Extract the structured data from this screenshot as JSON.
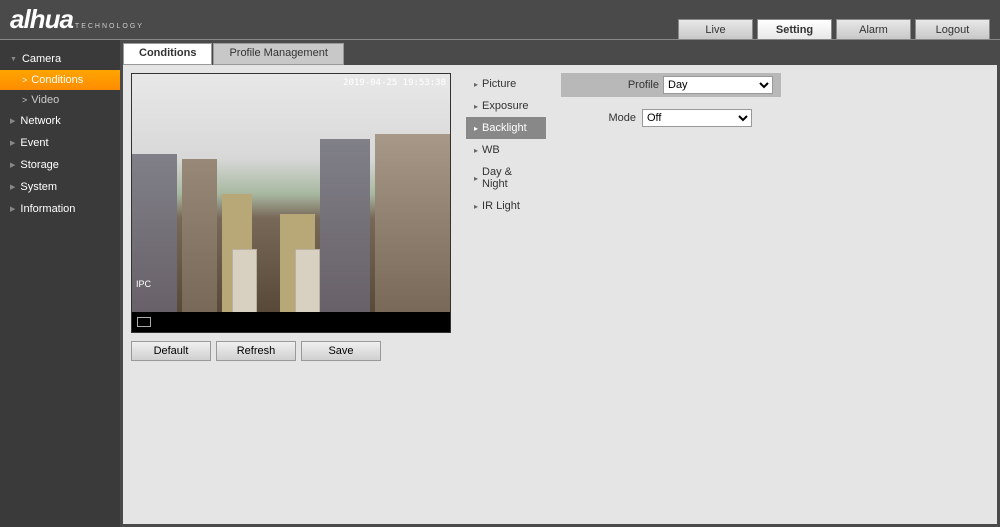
{
  "brand": {
    "name": "alhua",
    "tagline": "TECHNOLOGY"
  },
  "topNav": {
    "live": "Live",
    "setting": "Setting",
    "alarm": "Alarm",
    "logout": "Logout"
  },
  "sidebar": {
    "camera": "Camera",
    "conditions": "Conditions",
    "video": "Video",
    "network": "Network",
    "event": "Event",
    "storage": "Storage",
    "system": "System",
    "information": "Information"
  },
  "tabs": {
    "conditions": "Conditions",
    "profileManagement": "Profile Management"
  },
  "video": {
    "timestamp": "2019-04-25 19:53:38",
    "watermark": "IPC"
  },
  "actions": {
    "default": "Default",
    "refresh": "Refresh",
    "save": "Save"
  },
  "settingsMenu": {
    "picture": "Picture",
    "exposure": "Exposure",
    "backlight": "Backlight",
    "wb": "WB",
    "dayNight": "Day & Night",
    "irLight": "IR Light"
  },
  "fields": {
    "profileLabel": "Profile",
    "profileValue": "Day",
    "modeLabel": "Mode",
    "modeValue": "Off"
  }
}
